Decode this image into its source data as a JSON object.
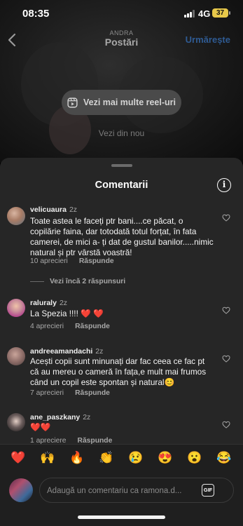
{
  "status": {
    "time": "08:35",
    "network": "4G",
    "battery": "37"
  },
  "header": {
    "username": "ANDRA",
    "title": "Postări",
    "follow_label": "Urmărește"
  },
  "reels": {
    "more_label": "Vezi mai multe reel-uri",
    "see_new_label": "Vezi din nou"
  },
  "sheet": {
    "title": "Comentarii"
  },
  "comments": [
    {
      "username": "velicuaura",
      "age": "2z",
      "text": "Toate astea le faceți ptr bani....ce păcat, o copilărie faina, dar totodată totul forțat, în fata camerei, de mici a- ți dat de gustul banilor.....nimic natural și ptr vârstă voastră!",
      "likes": "10 aprecieri",
      "reply_label": "Răspunde",
      "more_replies": "Vezi încă 2 răspunsuri"
    },
    {
      "username": "raluraly",
      "age": "2z",
      "text": "La Spezia !!!! ❤️ ❤️",
      "likes": "4 aprecieri",
      "reply_label": "Răspunde"
    },
    {
      "username": "andreeamandachi",
      "age": "2z",
      "text": "Acești copii sunt minunați dar fac ceea ce fac pt că au mereu o cameră în fața,e mult mai frumos când un copil este spontan și natural😊",
      "likes": "7 aprecieri",
      "reply_label": "Răspunde"
    },
    {
      "username": "ane_paszkany",
      "age": "2z",
      "text": "❤️❤️",
      "likes": "1 apreciere",
      "reply_label": "Răspunde"
    }
  ],
  "reactions": [
    "❤️",
    "🙌",
    "🔥",
    "👏",
    "😢",
    "😍",
    "😮",
    "😂"
  ],
  "composer": {
    "placeholder": "Adaugă un comentariu ca ramona.d...",
    "gif_label": "GIF"
  },
  "colors": {
    "accent_link": "#2f5b93",
    "sheet_bg": "#262626",
    "pill_bg": "#4a4a4a",
    "battery": "#e7c84a"
  }
}
